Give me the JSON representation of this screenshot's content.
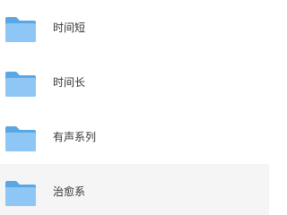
{
  "folders": [
    {
      "name": "时间短",
      "icon": "folder-icon"
    },
    {
      "name": "时间长",
      "icon": "folder-icon"
    },
    {
      "name": "有声系列",
      "icon": "folder-icon"
    },
    {
      "name": "治愈系",
      "icon": "folder-icon",
      "hovered": true
    }
  ],
  "colors": {
    "folder_back": "#5aa7e6",
    "folder_front": "#8ec7f5",
    "hover_bg": "#f5f5f5",
    "text": "#333333"
  }
}
